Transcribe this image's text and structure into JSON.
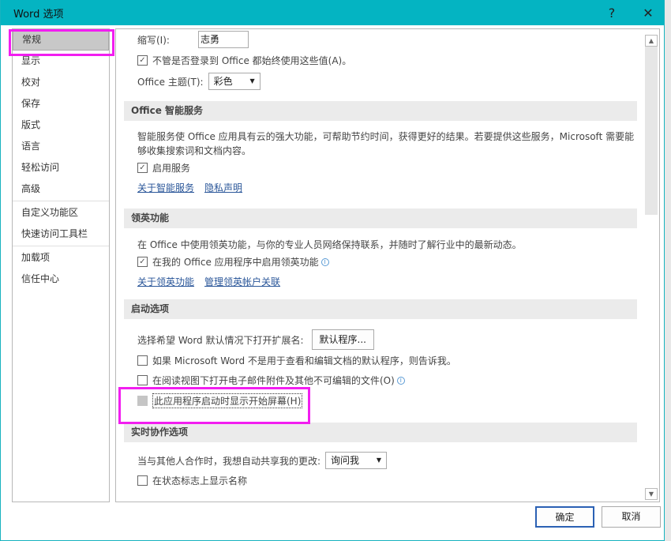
{
  "window": {
    "title": "Word 选项",
    "help": "?",
    "close": "✕"
  },
  "sidebar": {
    "items": [
      {
        "label": "常规"
      },
      {
        "label": "显示"
      },
      {
        "label": "校对"
      },
      {
        "label": "保存"
      },
      {
        "label": "版式"
      },
      {
        "label": "语言"
      },
      {
        "label": "轻松访问"
      },
      {
        "label": "高级"
      },
      {
        "label": "自定义功能区"
      },
      {
        "label": "快速访问工具栏"
      },
      {
        "label": "加载项"
      },
      {
        "label": "信任中心"
      }
    ]
  },
  "general": {
    "initials_label": "缩写(I):",
    "initials_value": "志勇",
    "always_use_label": "不管是否登录到 Office 都始终使用这些值(A)。",
    "theme_label": "Office 主题(T):",
    "theme_value": "彩色"
  },
  "intelligent": {
    "header": "Office 智能服务",
    "desc1": "智能服务使 Office 应用具有云的强大功能，可帮助节约时间，获得更好的结果。若要提供这些服务，Microsoft 需要能",
    "desc2": "够收集搜索词和文档内容。",
    "enable": "启用服务",
    "link_about": "关于智能服务",
    "link_privacy": "隐私声明"
  },
  "linkedin": {
    "header": "领英功能",
    "desc": "在 Office 中使用领英功能，与你的专业人员网络保持联系，并随时了解行业中的最新动态。",
    "enable": "在我的 Office 应用程序中启用领英功能",
    "link_about": "关于领英功能",
    "link_manage": "管理领英帐户关联"
  },
  "startup": {
    "header": "启动选项",
    "ext_label": "选择希望 Word 默认情况下打开扩展名:",
    "default_programs": "默认程序...",
    "tell_me": "如果 Microsoft Word 不是用于查看和编辑文档的默认程序，则告诉我。",
    "reading_view": "在阅读视图下打开电子邮件附件及其他不可编辑的文件(O)",
    "start_screen": "此应用程序启动时显示开始屏幕(H)"
  },
  "coauth": {
    "header": "实时协作选项",
    "share_label": "当与其他人合作时，我想自动共享我的更改:",
    "share_value": "询问我",
    "show_names": "在状态标志上显示名称"
  },
  "footer": {
    "ok": "确定",
    "cancel": "取消"
  }
}
